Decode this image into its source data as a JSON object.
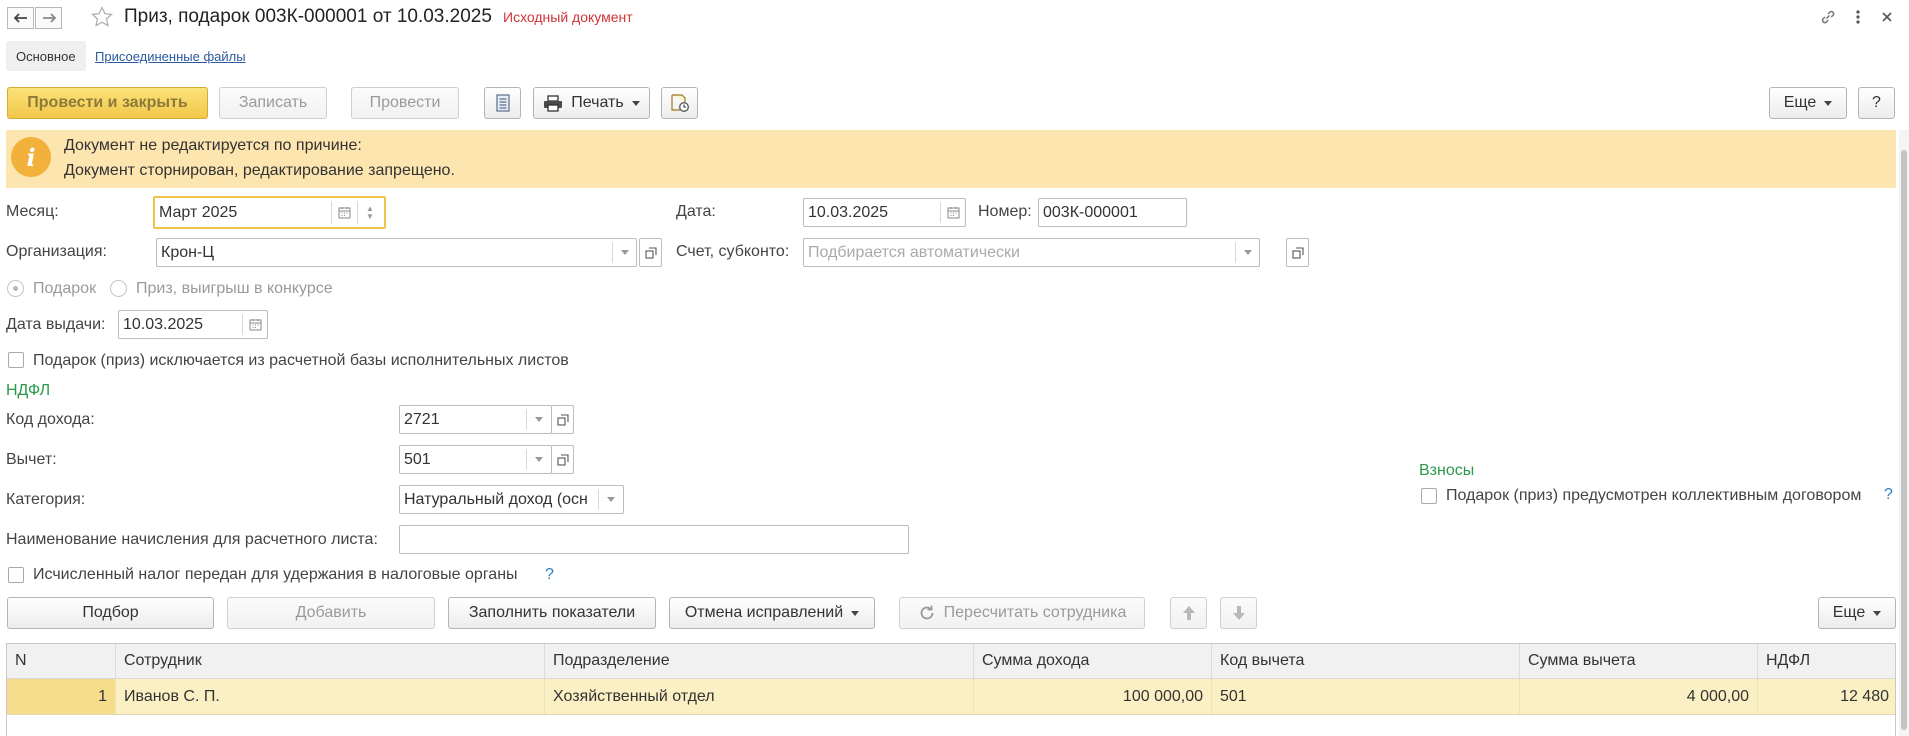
{
  "window": {
    "title": "Приз, подарок 003К-000001 от 10.03.2025",
    "status": "Исходный документ"
  },
  "tabs": {
    "main": "Основное",
    "files": "Присоединенные файлы"
  },
  "toolbar": {
    "post_close": "Провести и закрыть",
    "save": "Записать",
    "post": "Провести",
    "print": "Печать",
    "more": "Еще",
    "help": "?"
  },
  "banner": {
    "line1": "Документ не редактируется по причине:",
    "line2": "Документ сторнирован, редактирование запрещено."
  },
  "form": {
    "month_label": "Месяц:",
    "month_value": "Март 2025",
    "date_label": "Дата:",
    "date_value": "10.03.2025",
    "number_label": "Номер:",
    "number_value": "003К-000001",
    "org_label": "Организация:",
    "org_value": "Крон-Ц",
    "account_label": "Счет, субконто:",
    "account_placeholder": "Подбирается автоматически",
    "radio_gift": "Подарок",
    "radio_prize": "Приз, выигрыш в конкурсе",
    "issue_date_label": "Дата выдачи:",
    "issue_date_value": "10.03.2025",
    "exclude_label": "Подарок (приз) исключается из расчетной базы исполнительных листов",
    "ndfl_section": "НДФЛ",
    "income_code_label": "Код дохода:",
    "income_code_value": "2721",
    "deduction_label": "Вычет:",
    "deduction_value": "501",
    "category_label": "Категория:",
    "category_value": "Натуральный доход (осн",
    "accrual_name_label": "Наименование начисления для расчетного листа:",
    "accrual_name_value": "",
    "tax_transferred_label": "Исчисленный налог передан для удержания в налоговые органы",
    "tax_help": "?",
    "contrib_section": "Взносы",
    "collective_label": "Подарок (приз) предусмотрен коллективным договором",
    "collective_help": "?"
  },
  "table_toolbar": {
    "pick": "Подбор",
    "add": "Добавить",
    "fill": "Заполнить показатели",
    "cancel_fix": "Отмена исправлений",
    "recalc": "Пересчитать сотрудника",
    "more": "Еще"
  },
  "table": {
    "columns": [
      "N",
      "Сотрудник",
      "Подразделение",
      "Сумма дохода",
      "Код вычета",
      "Сумма вычета",
      "НДФЛ"
    ],
    "rows": [
      [
        "1",
        "Иванов С. П.",
        "Хозяйственный отдел",
        "100 000,00",
        "501",
        "4 000,00",
        "12 480"
      ]
    ]
  },
  "colors": {
    "primary_button": "#f2c84a",
    "banner_bg": "#fde5b0",
    "banner_icon": "#f2b13b",
    "section_title": "#2a9a4a",
    "status_red": "#d0343a",
    "selected_row": "#fbf0c4"
  },
  "icons": [
    "back-arrow-icon",
    "forward-arrow-icon",
    "star-icon",
    "link-icon",
    "more-vertical-icon",
    "close-icon",
    "document-list-icon",
    "printer-icon",
    "document-structure-icon",
    "info-icon",
    "calendar-icon",
    "open-icon",
    "refresh-icon",
    "arrow-up-icon",
    "arrow-down-icon"
  ]
}
